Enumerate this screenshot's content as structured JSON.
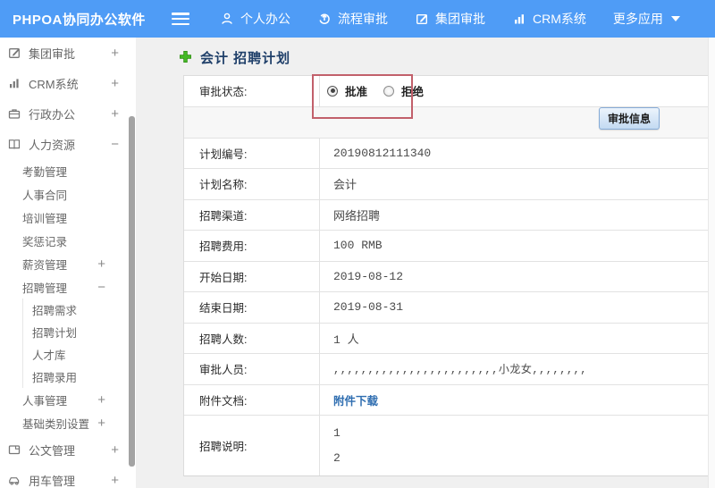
{
  "colors": {
    "header_blue": "#4f9cf6",
    "accent_green": "#44b826",
    "link_blue": "#2e6db0",
    "annotation_red": "#c2606b"
  },
  "topbar": {
    "brand": "PHPOA协同办公软件",
    "nav": [
      {
        "label": "个人办公",
        "icon": "person-icon"
      },
      {
        "label": "流程审批",
        "icon": "process-cycle-icon"
      },
      {
        "label": "集团审批",
        "icon": "edit-square-icon"
      },
      {
        "label": "CRM系统",
        "icon": "bar-chart-icon"
      },
      {
        "label": "更多应用",
        "icon": "caret-down-icon"
      }
    ]
  },
  "sidebar": {
    "items": [
      {
        "label": "集团审批",
        "icon": "edit-square-icon",
        "toggle": "+"
      },
      {
        "label": "CRM系统",
        "icon": "bar-chart-icon",
        "toggle": "+"
      },
      {
        "label": "行政办公",
        "icon": "briefcase-icon",
        "toggle": "+"
      },
      {
        "label": "人力资源",
        "icon": "book-icon",
        "toggle": "−"
      },
      {
        "label": "考勤管理"
      },
      {
        "label": "人事合同"
      },
      {
        "label": "培训管理"
      },
      {
        "label": "奖惩记录"
      },
      {
        "label": "薪资管理",
        "toggle": "+"
      },
      {
        "label": "招聘管理",
        "toggle": "−"
      },
      {
        "label": "招聘需求"
      },
      {
        "label": "招聘计划"
      },
      {
        "label": "人才库"
      },
      {
        "label": "招聘录用"
      },
      {
        "label": "人事管理",
        "toggle": "+"
      },
      {
        "label": "基础类别设置",
        "toggle": "+"
      },
      {
        "label": "公文管理",
        "icon": "document-icon",
        "toggle": "+"
      },
      {
        "label": "用车管理",
        "icon": "car-icon",
        "toggle": "+"
      }
    ]
  },
  "main": {
    "title": "会计 招聘计划",
    "status_row": {
      "label": "审批状态:",
      "radios": [
        {
          "label": "批准",
          "checked": true
        },
        {
          "label": "拒绝",
          "checked": false
        }
      ]
    },
    "approve_button": "审批信息",
    "rows": [
      {
        "label": "计划编号:",
        "value": "20190812111340"
      },
      {
        "label": "计划名称:",
        "value": "会计"
      },
      {
        "label": "招聘渠道:",
        "value": "网络招聘"
      },
      {
        "label": "招聘费用:",
        "value": "100 RMB"
      },
      {
        "label": "开始日期:",
        "value": "2019-08-12"
      },
      {
        "label": "结束日期:",
        "value": "2019-08-31"
      },
      {
        "label": "招聘人数:",
        "value": "1 人"
      },
      {
        "label": "审批人员:",
        "value": ",,,,,,,,,,,,,,,,,,,,,,,,小龙女,,,,,,,,"
      },
      {
        "label": "附件文档:",
        "link": "附件下载"
      },
      {
        "label": "招聘说明:",
        "lines": [
          "1",
          "2"
        ]
      }
    ]
  },
  "icons": {
    "hamburger-icon": "three horizontal bars",
    "person-icon": "user silhouette",
    "process-cycle-icon": "circular arrow with up arrow",
    "edit-square-icon": "square with pen",
    "bar-chart-icon": "three vertical bars",
    "caret-down-icon": "down triangle",
    "briefcase-icon": "briefcase outline",
    "book-icon": "open book",
    "document-icon": "document folder",
    "car-icon": "car outline",
    "add-icon": "green plus"
  }
}
